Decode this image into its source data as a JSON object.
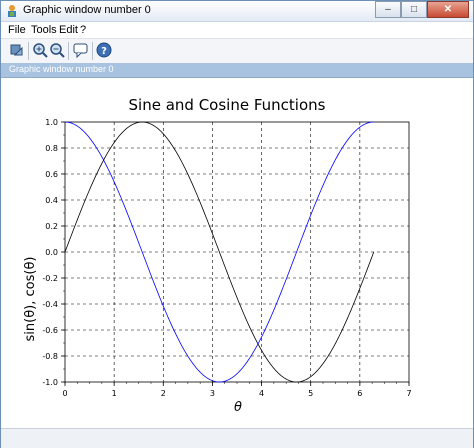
{
  "window": {
    "title": "Graphic window number 0",
    "controls": {
      "minimize": "–",
      "maximize": "□",
      "close": "✕"
    }
  },
  "menu": {
    "items": [
      "File",
      "Tools",
      "Edit",
      "?"
    ]
  },
  "toolbar": {
    "icons": [
      "rotate-icon",
      "zoom-in-icon",
      "zoom-out-icon",
      "datatip-icon",
      "help-icon"
    ]
  },
  "panel": {
    "label": "Graphic window number 0"
  },
  "chart_data": {
    "type": "line",
    "title": "Sine and Cosine Functions",
    "xlabel": "θ",
    "ylabel": "sin(θ), cos(θ)",
    "xlim": [
      0,
      7
    ],
    "ylim": [
      -1,
      1
    ],
    "xticks": [
      "0",
      "1",
      "2",
      "3",
      "4",
      "5",
      "6",
      "7"
    ],
    "yticks": [
      "1.0",
      "0.8",
      "0.6",
      "0.4",
      "0.2",
      "0.0",
      "-0.2",
      "-0.4",
      "-0.6",
      "-0.8",
      "-1.0"
    ],
    "grid": true,
    "grid_style": "dashed",
    "x_range_of_curves": [
      0,
      6.283
    ],
    "series": [
      {
        "function": "sin",
        "color": "#000000"
      },
      {
        "function": "cos",
        "color": "#0000ff"
      }
    ]
  }
}
